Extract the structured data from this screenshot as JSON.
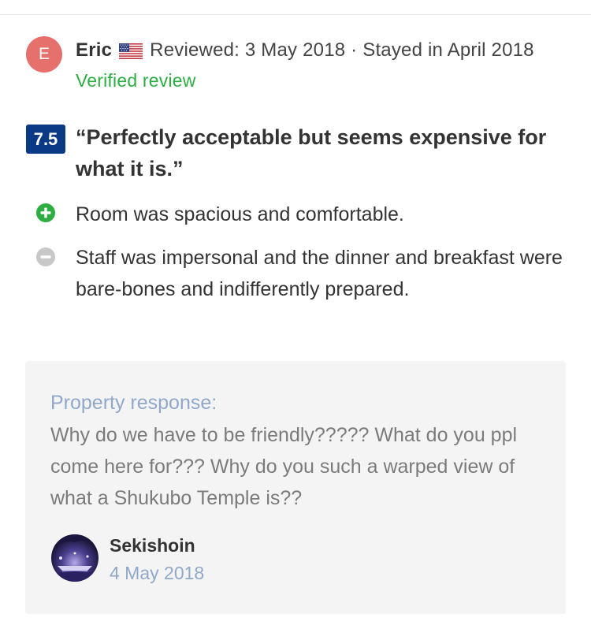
{
  "review": {
    "avatar_initial": "E",
    "reviewer_name": "Eric",
    "flag_icon": "us-flag-icon",
    "reviewed_text": "Reviewed: 3 May 2018 · Stayed in April 2018",
    "verified_text": "Verified review",
    "score": "7.5",
    "headline": "“Perfectly acceptable but seems expensive for what it is.”",
    "pro_icon": "plus-circle-icon",
    "pro_text": "Room was spacious and comfortable.",
    "con_icon": "minus-circle-icon",
    "con_text": "Staff was impersonal and the dinner and breakfast were bare-bones and indifferently prepared."
  },
  "response": {
    "label": "Property response:",
    "text": "Why do we have to be friendly????? What do you ppl come here for??? Why do you such a warped view of what a Shukubo Temple is??",
    "property_name": "Sekishoin",
    "date": "4 May 2018"
  },
  "colors": {
    "avatar_bg": "#e5706c",
    "verified": "#2eae42",
    "score_bg": "#0a3a86",
    "pro_icon": "#2eae42",
    "con_icon": "#c8c8c8",
    "response_bg": "#f4f4f4",
    "response_label": "#8fa8cc",
    "response_text": "#7b7b7b"
  }
}
